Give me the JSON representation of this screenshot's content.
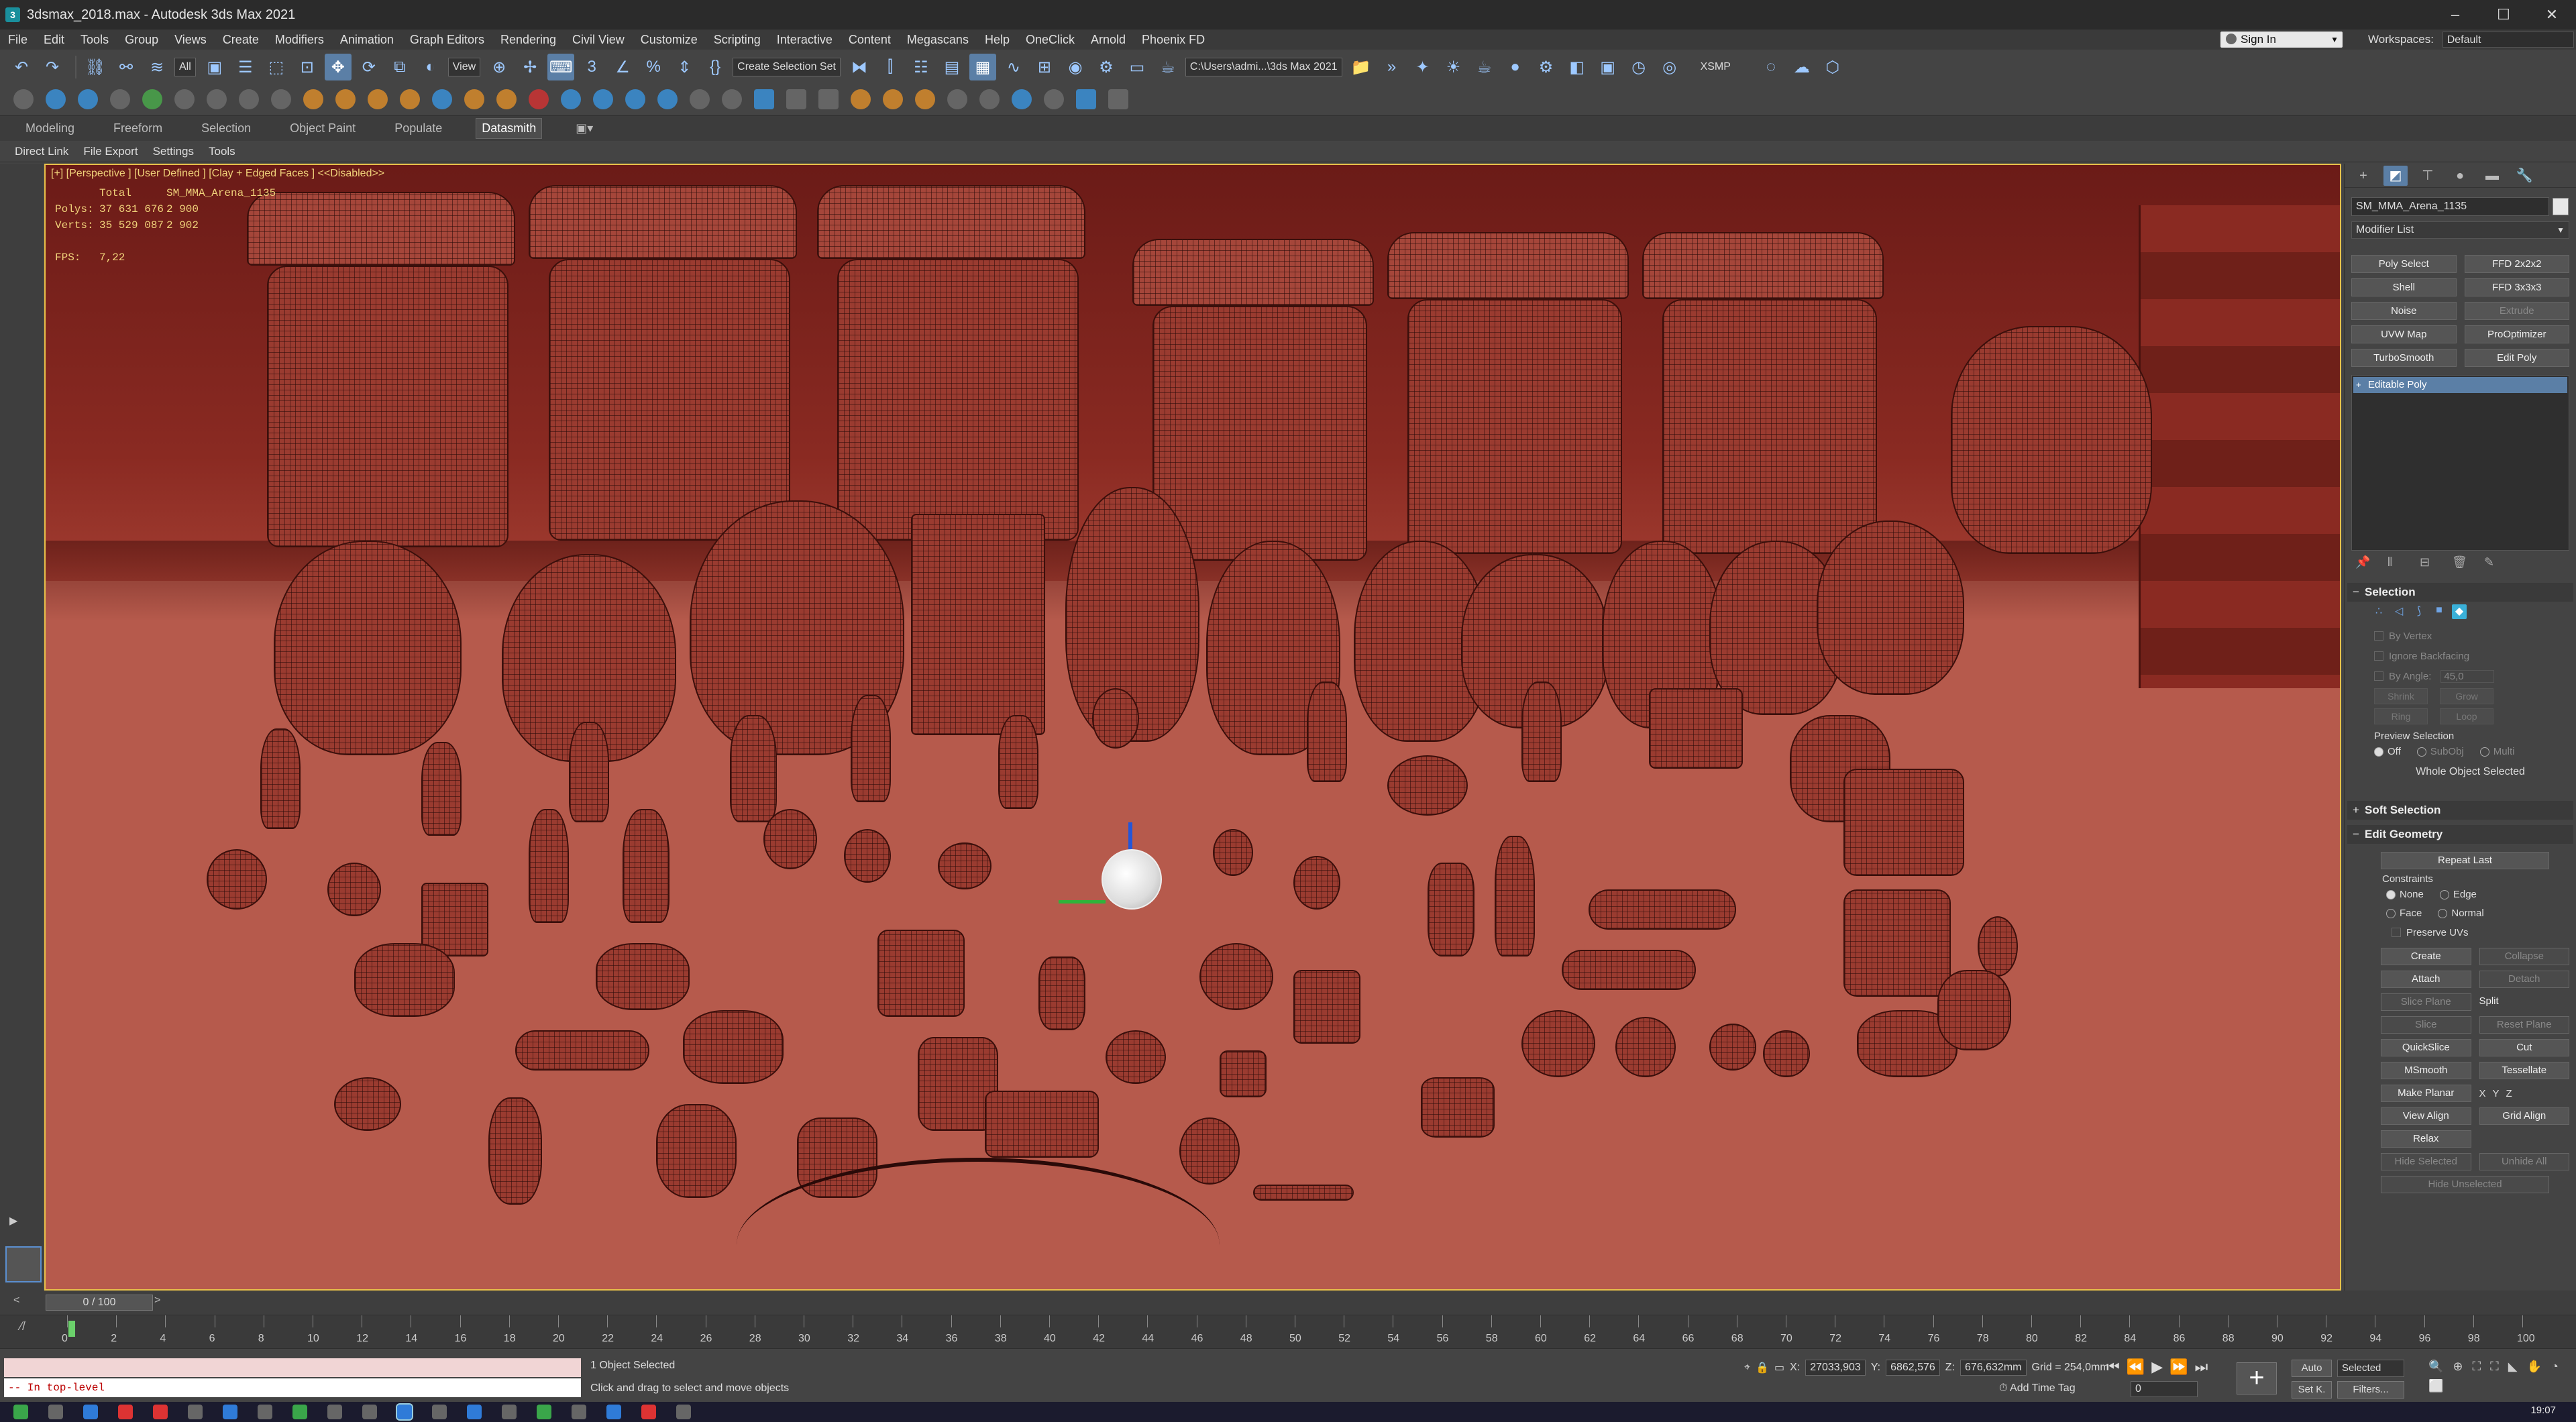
{
  "window": {
    "title": "3dsmax_2018.max - Autodesk 3ds Max 2021",
    "app_icon": "3ds-max-icon",
    "controls": [
      "minimize-icon",
      "maximize-icon",
      "close-icon"
    ]
  },
  "menubar": {
    "items": [
      "File",
      "Edit",
      "Tools",
      "Group",
      "Views",
      "Create",
      "Modifiers",
      "Animation",
      "Graph Editors",
      "Rendering",
      "Civil View",
      "Customize",
      "Scripting",
      "Interactive",
      "Content",
      "Megascans",
      "Help",
      "OneClick",
      "Arnold",
      "Phoenix FD"
    ],
    "sign_in": "Sign In",
    "workspaces_label": "Workspaces:",
    "workspaces_value": "Default"
  },
  "toolbar": {
    "selection_filter": "All",
    "ref_coord": "View",
    "named_sel_set": "Create Selection Set",
    "project_path": "C:\\Users\\admi...\\3ds Max 2021",
    "xsmp": "XSMP"
  },
  "ribbon": {
    "tabs": [
      "Modeling",
      "Freeform",
      "Selection",
      "Object Paint",
      "Populate",
      "Datasmith"
    ],
    "active_tab": "Datasmith",
    "sub_items": [
      "Direct Link",
      "File Export",
      "Settings",
      "Tools"
    ]
  },
  "viewport": {
    "label": "[+] [Perspective ] [User Defined ] [Clay + Edged Faces ] <<Disabled>>",
    "stats": {
      "total_label": "Total",
      "object_name": "SM_MMA_Arena_1135",
      "polys_label": "Polys:",
      "polys_total": "37 631 676",
      "polys_sel": "2 900",
      "verts_label": "Verts:",
      "verts_total": "35 529 087",
      "verts_sel": "2 902",
      "fps_label": "FPS:",
      "fps_value": "7,22"
    }
  },
  "command_panel": {
    "tabs": [
      "create-icon",
      "modify-icon",
      "hierarchy-icon",
      "motion-icon",
      "display-icon",
      "utilities-icon"
    ],
    "object_name": "SM_MMA_Arena_1135",
    "modifier_list": "Modifier List",
    "modifier_buttons": [
      {
        "label": "Poly Select",
        "disabled": false
      },
      {
        "label": "FFD 2x2x2",
        "disabled": false
      },
      {
        "label": "Shell",
        "disabled": false
      },
      {
        "label": "FFD 3x3x3",
        "disabled": false
      },
      {
        "label": "Noise",
        "disabled": false
      },
      {
        "label": "Extrude",
        "disabled": true
      },
      {
        "label": "UVW Map",
        "disabled": false
      },
      {
        "label": "ProOptimizer",
        "disabled": false
      },
      {
        "label": "TurboSmooth",
        "disabled": false
      },
      {
        "label": "Edit Poly",
        "disabled": false
      }
    ],
    "stack_item": "Editable Poly",
    "selection": {
      "title": "Selection",
      "by_vertex": "By Vertex",
      "ignore_backfacing": "Ignore Backfacing",
      "by_angle": "By Angle:",
      "angle_value": "45,0",
      "shrink": "Shrink",
      "grow": "Grow",
      "ring": "Ring",
      "loop": "Loop",
      "preview_selection": "Preview Selection",
      "preview_off": "Off",
      "preview_subobj": "SubObj",
      "preview_multi": "Multi",
      "whole_object": "Whole Object Selected"
    },
    "soft_selection": "Soft Selection",
    "edit_geometry": {
      "title": "Edit Geometry",
      "repeat_last": "Repeat Last",
      "constraints": "Constraints",
      "none": "None",
      "edge": "Edge",
      "face": "Face",
      "normal": "Normal",
      "preserve_uvs": "Preserve UVs",
      "create": "Create",
      "collapse": "Collapse",
      "attach": "Attach",
      "detach": "Detach",
      "slice_plane": "Slice Plane",
      "split": "Split",
      "slice": "Slice",
      "reset_plane": "Reset Plane",
      "quickslice": "QuickSlice",
      "cut": "Cut",
      "msmooth": "MSmooth",
      "tessellate": "Tessellate",
      "make_planar": "Make Planar",
      "x": "X",
      "y": "Y",
      "z": "Z",
      "view_align": "View Align",
      "grid_align": "Grid Align",
      "relax": "Relax",
      "hide_selected": "Hide Selected",
      "unhide_all": "Unhide All",
      "hide_unselected": "Hide Unselected"
    }
  },
  "timeline": {
    "slider": "0 / 100",
    "ticks": [
      "0",
      "2",
      "4",
      "6",
      "8",
      "10",
      "12",
      "14",
      "16",
      "18",
      "20",
      "22",
      "24",
      "26",
      "28",
      "30",
      "32",
      "34",
      "36",
      "38",
      "40",
      "42",
      "44",
      "46",
      "48",
      "50",
      "52",
      "54",
      "56",
      "58",
      "60",
      "62",
      "64",
      "66",
      "68",
      "70",
      "72",
      "74",
      "76",
      "78",
      "80",
      "82",
      "84",
      "86",
      "88",
      "90",
      "92",
      "94",
      "96",
      "98",
      "100"
    ]
  },
  "status": {
    "maxscript_line2": "-- In top-level",
    "selected": "1 Object Selected",
    "hint": "Click and drag to select and move objects",
    "x_label": "X:",
    "x_value": "27033,903",
    "y_label": "Y:",
    "y_value": "6862,576",
    "z_label": "Z:",
    "z_value": "676,632mm",
    "grid": "Grid = 254,0mm",
    "add_time_tag": "Add Time Tag",
    "frame": "0",
    "auto": "Auto",
    "set_k": "Set K.",
    "selected_dd": "Selected",
    "filters": "Filters...",
    "clock": "19:07"
  }
}
